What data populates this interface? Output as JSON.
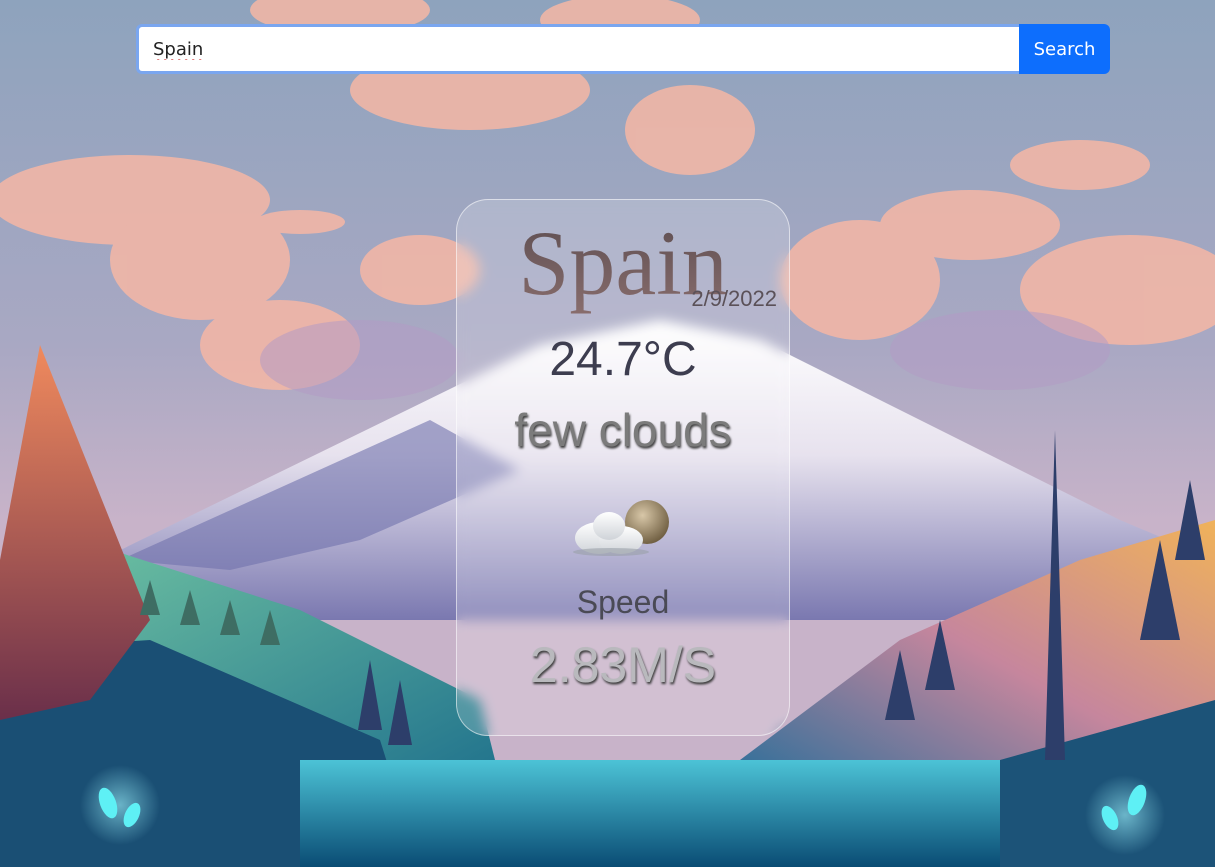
{
  "search": {
    "value": "Spain",
    "button_label": "Search"
  },
  "weather": {
    "city": "Spain",
    "date": "2/9/2022",
    "temperature": "24.7°C",
    "description": "few clouds",
    "icon": "few-clouds-icon",
    "speed_label": "Speed",
    "speed_value": "2.83M/S"
  },
  "colors": {
    "search_button": "#0d6efd",
    "input_border": "#7aa6ef"
  }
}
